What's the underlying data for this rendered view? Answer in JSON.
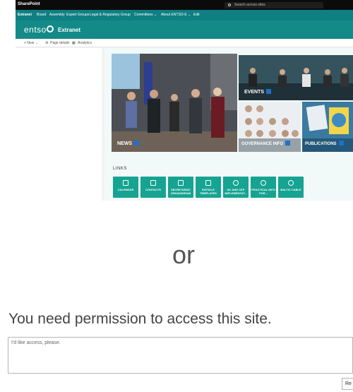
{
  "suite_bar": {
    "brand": "SharePoint",
    "search_placeholder": "Search across sites"
  },
  "top_nav": [
    "Extranet",
    "Board",
    "Assembly",
    "Expert Groups",
    "Legal & Regulatory Group",
    "Committees ⌄",
    "About ENTSO-E ⌄",
    "Edit"
  ],
  "site": {
    "logo_text": "entso",
    "title": "Extranet"
  },
  "command_bar": {
    "new": "+ New ⌄",
    "page_details": "Page details",
    "analytics": "Analytics"
  },
  "tiles": {
    "news": "NEWS",
    "events": "EVENTS",
    "governance": "GOVERNANCE INFO",
    "publications": "PUBLICATIONS"
  },
  "links_heading": "LINKS",
  "quick_links": [
    "CALENDAR",
    "CONTACTS",
    "SECRETARIAT ORGANIGRAM",
    "ENTSO-E TEMPLATES",
    "NC AND CEP IMPLEMENTAT...",
    "PRACTICAL INFO FOR...",
    "BALTIC CABLE"
  ],
  "separator": "or",
  "permission": {
    "title": "You need permission to access this site.",
    "placeholder": "I'd like access, please.",
    "button": "Re"
  },
  "colors": {
    "nav": "#0f7f83",
    "header": "#138a88",
    "quick_link": "#16a391",
    "suite_bar": "#0b0b0b"
  }
}
